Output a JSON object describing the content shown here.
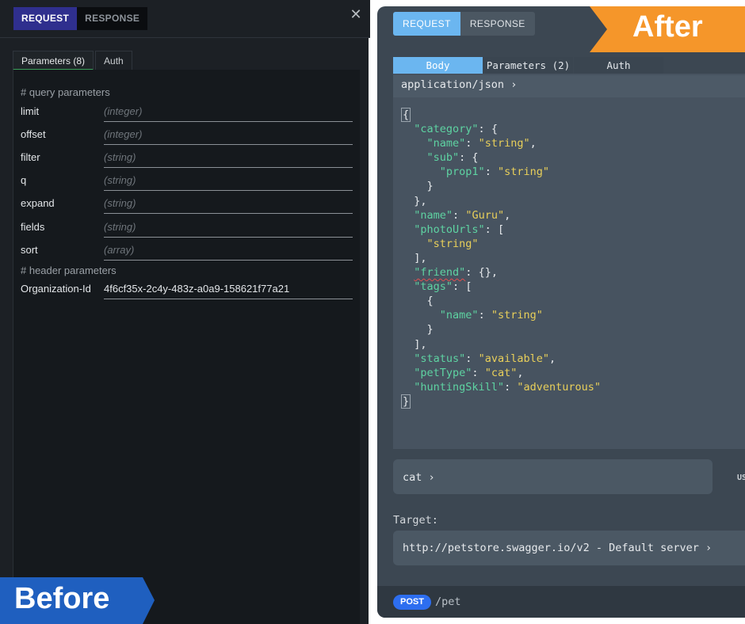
{
  "before": {
    "label": "Before",
    "toggle": {
      "request": "REQUEST",
      "response": "RESPONSE"
    },
    "close_glyph": "✕",
    "tabs": [
      "Parameters (8)",
      "Auth"
    ],
    "query_comment": "# query parameters",
    "header_comment": "# header parameters",
    "query_params": [
      {
        "name": "limit",
        "placeholder": "(integer)"
      },
      {
        "name": "offset",
        "placeholder": "(integer)"
      },
      {
        "name": "filter",
        "placeholder": "(string)"
      },
      {
        "name": "q",
        "placeholder": "(string)"
      },
      {
        "name": "expand",
        "placeholder": "(string)"
      },
      {
        "name": "fields",
        "placeholder": "(string)"
      },
      {
        "name": "sort",
        "placeholder": "(array)"
      }
    ],
    "header_params": [
      {
        "name": "Organization-Id",
        "value": "4f6cf35x-2c4y-483z-a0a9-158621f77a21"
      }
    ]
  },
  "after": {
    "label": "After",
    "toggle": {
      "request": "REQUEST",
      "response": "RESPONSE"
    },
    "tabs": [
      "Body",
      "Parameters (2)",
      "Auth"
    ],
    "content_type": "application/json",
    "body_lines": [
      "{",
      "  \"category\": {",
      "    \"name\": \"string\",",
      "    \"sub\": {",
      "      \"prop1\": \"string\"",
      "    }",
      "  },",
      "  \"name\": \"Guru\",",
      "  \"photoUrls\": [",
      "    \"string\"",
      "  ],",
      "  \"friend\": {},",
      "  \"tags\": [",
      "    {",
      "      \"name\": \"string\"",
      "    }",
      "  ],",
      "  \"status\": \"available\",",
      "  \"petType\": \"cat\",",
      "  \"huntingSkill\": \"adventurous\"",
      "}"
    ],
    "example_select": "cat",
    "side_text": "US",
    "target_label": "Target:",
    "target_value": "http://petstore.swagger.io/v2 - Default server",
    "method": "POST",
    "path": "/pet"
  },
  "colors": {
    "before_accent": "#2f2f8e",
    "after_accent": "#6bb6f0",
    "label_blue": "#1f5fbf",
    "label_orange": "#f5962a",
    "json_key": "#5ed3a2",
    "json_string": "#e8cf5a",
    "post_badge": "#2d6ef0"
  }
}
